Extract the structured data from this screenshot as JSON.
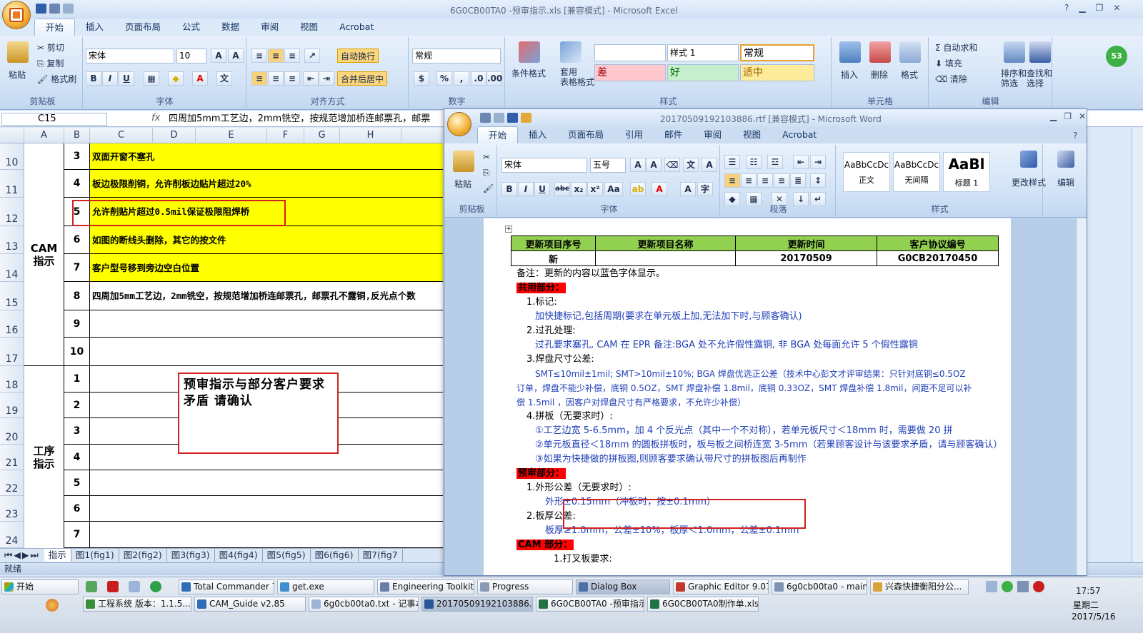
{
  "excel": {
    "title": "6G0CB00TA0 -预审指示.xls  [兼容模式] - Microsoft Excel",
    "tabs": [
      "开始",
      "插入",
      "页面布局",
      "公式",
      "数据",
      "审阅",
      "视图",
      "Acrobat"
    ],
    "clipboard": {
      "paste": "粘贴",
      "cut": "剪切",
      "copy": "复制",
      "format_painter": "格式刷",
      "label": "剪贴板"
    },
    "font": {
      "name": "宋体",
      "size": "10",
      "label": "字体"
    },
    "alignment": {
      "wrap": "自动换行",
      "merge": "合并后居中",
      "label": "对齐方式"
    },
    "number": {
      "format": "常规",
      "label": "数字"
    },
    "styles": {
      "conditional": "条件格式",
      "table": "套用\n表格格式",
      "style1": "样式 1",
      "normal": "常规",
      "bad": "差",
      "good": "好",
      "neutral": "适中",
      "label": "样式"
    },
    "cells": {
      "insert": "插入",
      "delete": "删除",
      "format": "格式",
      "label": "单元格"
    },
    "editing": {
      "autosum": "自动求和",
      "fill": "填充",
      "clear": "清除",
      "sort": "排序和\n筛选",
      "find": "查找和\n选择",
      "label": "编辑"
    },
    "cell_ref": "C15",
    "fx": "fx",
    "formula": "四周加5mm工艺边，2mm铣空，按规范增加桥连邮票孔，邮票",
    "columns": [
      "A",
      "B",
      "C",
      "D",
      "E",
      "F",
      "G",
      "H"
    ],
    "row_numbers": [
      "10",
      "11",
      "12",
      "13",
      "14",
      "15",
      "16",
      "17",
      "18",
      "19",
      "20",
      "21",
      "22",
      "23",
      "24"
    ],
    "cam_label": "CAM\n指示",
    "process_label": "工序\n指示",
    "cam_rows": [
      {
        "no": "3",
        "text": "双面开窗不塞孔"
      },
      {
        "no": "4",
        "text": "板边极限削铜，允许削板边贴片超过20%"
      },
      {
        "no": "5",
        "text": "允许削贴片超过0.5mil保证极限阻焊桥"
      },
      {
        "no": "6",
        "text": "如图的断线头删除，其它的按文件"
      },
      {
        "no": "7",
        "text": "客户型号移到旁边空白位置"
      },
      {
        "no": "8",
        "text": "四周加5mm工艺边，2mm铣空，按规范增加桥连邮票孔，邮票孔不露铜,反光点个数"
      },
      {
        "no": "9",
        "text": ""
      },
      {
        "no": "10",
        "text": ""
      }
    ],
    "process_rows": [
      "1",
      "2",
      "3",
      "4",
      "5",
      "6",
      "7"
    ],
    "note": "预审指示与部分客户要求矛盾 请确认",
    "sheet_tabs": [
      "指示",
      "图1(fig1)",
      "图2(fig2)",
      "图3(fig3)",
      "图4(fig4)",
      "图5(fig5)",
      "图6(fig6)",
      "图7(fig7"
    ],
    "status": "就绪"
  },
  "word": {
    "title": "20170509192103886.rtf [兼容模式] - Microsoft Word",
    "tabs": [
      "开始",
      "插入",
      "页面布局",
      "引用",
      "邮件",
      "审阅",
      "视图",
      "Acrobat"
    ],
    "clipboard_label": "剪贴板",
    "paste": "粘贴",
    "font": {
      "name": "宋体",
      "size": "五号",
      "label": "字体"
    },
    "paragraph_label": "段落",
    "styles": [
      {
        "sample": "AaBbCcDc",
        "name": "正文"
      },
      {
        "sample": "AaBbCcDc",
        "name": "无间隔"
      },
      {
        "sample": "AaBl",
        "name": "标题 1"
      }
    ],
    "styles_label": "样式",
    "change_styles": "更改样式",
    "edit": "编辑",
    "table": {
      "headers": [
        "更新项目序号",
        "更新项目名称",
        "更新时间",
        "客户协议编号"
      ],
      "row": [
        "新",
        "",
        "20170509",
        "G0CB20170450"
      ]
    },
    "lines": {
      "remark": "备注：更新的内容以蓝色字体显示。",
      "common": "共用部分：",
      "l1": "1.标记:",
      "l1a": "加快捷标记,包括周期(要求在单元板上加,无法加下时,与顾客确认)",
      "l2": "2.过孔处理:",
      "l2a": "过孔要求塞孔,     CAM 在 EPR 备注:BGA 处不允许假性露铜, 非 BGA 处每面允许 5 个假性露铜",
      "l3": "3.焊盘尺寸公差:",
      "l3a": "SMT≤10mil±1mil; SMT>10mil±10%; BGA 焊盘优选正公差（技术中心彭文才评审结果：只针对底铜≤0.5OZ",
      "l3b": "订单，焊盘不能少补偿，底铜 0.5OZ，SMT 焊盘补偿 1.8mil，底铜 0.33OZ，SMT 焊盘补偿 1.8mil，间距不足可以补",
      "l3c": "偿 1.5mil ，因客户对焊盘尺寸有严格要求，不允许少补偿）",
      "l4": "4.拼板（无要求时）:",
      "l4a": "①工艺边宽 5-6.5mm，加 4 个反光点（其中一个不对称），若单元板尺寸＜18mm 时，需要做 20 拼",
      "l4b": "②单元板直径＜18mm 的圆板拼板时，板与板之间桥连宽 3-5mm（若果顾客设计与该要求矛盾，请与顾客确认）",
      "l4c": "③如果为快捷做的拼板图,则顾客要求确认带尺寸的拼板图后再制作",
      "pre": "预审部分：",
      "p1": "1.外形公差（无要求时）:",
      "p1a": "外形±0.15mm（冲板时，按±0.1mm）",
      "p2": "2.板厚公差:",
      "p2a": "板厚≥1.0mm，公差±10%，板厚＜1.0mm，公差±0.1mm",
      "cam": "CAM 部分：",
      "c1": "1.打叉板要求:"
    }
  },
  "taskbar": {
    "start": "开始",
    "row1": [
      "Total Commander 7....",
      "get.exe",
      "Engineering Toolkit 9...",
      "Progress",
      "Dialog Box",
      "Graphic Editor 9.07b...",
      "6g0cb00ta0 - main_qa",
      "兴森快捷衡阳分公..."
    ],
    "row2": [
      "工程系统  版本：1.1.5...",
      "CAM_Guide v2.85",
      "6g0cb00ta0.txt - 记事本",
      "20170509192103886....",
      "6G0CB00TA0 -预审指示...",
      "6G0CB00TA0制作单.xls ..."
    ],
    "time": "17:57",
    "weekday": "星期二",
    "date": "2017/5/16"
  }
}
